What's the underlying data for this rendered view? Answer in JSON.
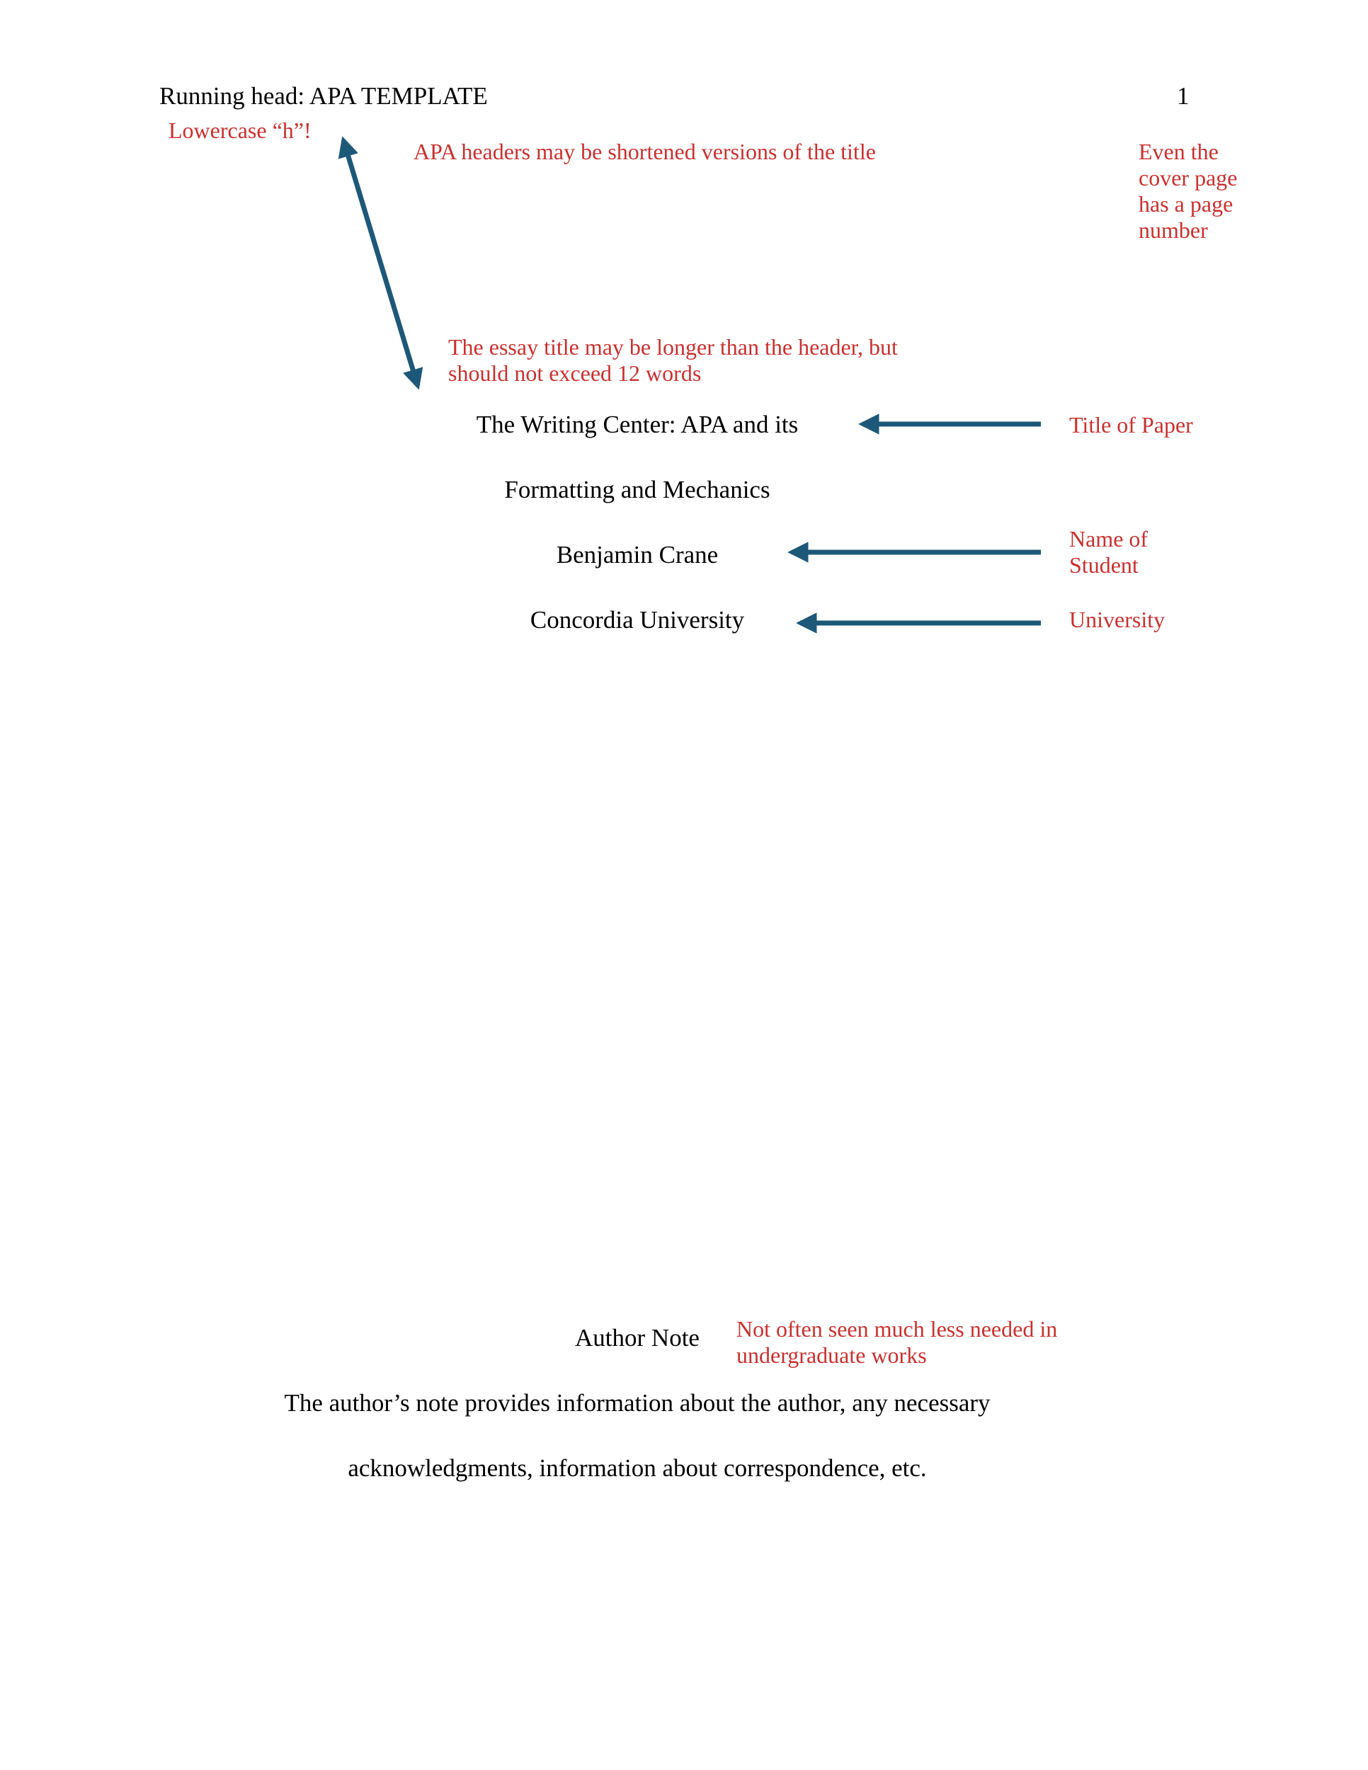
{
  "header": {
    "running_head": "Running head: APA TEMPLATE",
    "page_number": "1"
  },
  "annotations": {
    "lowercase_h": "Lowercase “h”!",
    "headers_shortened": "APA headers may be shortened versions of the title",
    "cover_page_number": [
      "Even the",
      "cover page",
      "has a page",
      "number"
    ],
    "title_length": [
      "The essay title may be longer than the header, but",
      "should not exceed 12 words"
    ],
    "title_of_paper": "Title of Paper",
    "name_of_student": [
      "Name of",
      "Student"
    ],
    "university": "University",
    "author_note_hint": [
      "Not often seen much less needed in",
      "undergraduate works"
    ]
  },
  "title_page": {
    "title_line_1": "The Writing Center: APA and its",
    "title_line_2": "Formatting and Mechanics",
    "author": "Benjamin Crane",
    "institution": "Concordia University"
  },
  "author_note": {
    "heading": "Author Note",
    "body_line_1": "The author’s note provides information about the author, any necessary",
    "body_line_2": "acknowledgments, information about correspondence, etc."
  },
  "colors": {
    "annotation_red": "#c8312f",
    "arrow_blue": "#1d5878",
    "text": "#000000"
  }
}
